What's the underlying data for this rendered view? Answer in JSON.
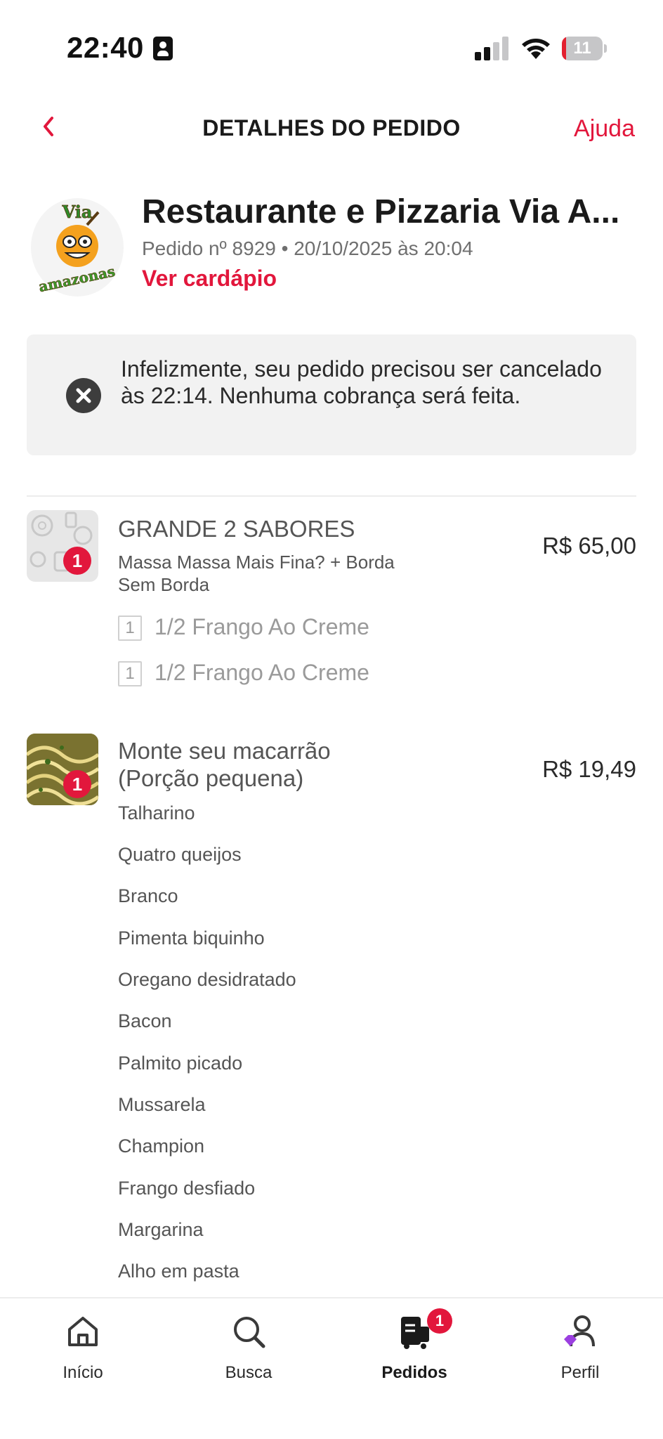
{
  "status_bar": {
    "time": "22:40",
    "battery": "11",
    "battery_level": 0.11
  },
  "header": {
    "title": "DETALHES DO PEDIDO",
    "help_label": "Ajuda"
  },
  "restaurant": {
    "name": "Restaurante e Pizzaria Via A...",
    "order_meta": "Pedido nº 8929 • 20/10/2025 às 20:04",
    "menu_link": "Ver cardápio",
    "logo_text_top": "Via",
    "logo_text_bottom": "amazonas"
  },
  "alert": {
    "icon": "close-circle-icon",
    "message": "Infelizmente, seu pedido precisou ser cancelado às 22:14. Nenhuma cobrança será feita."
  },
  "items": [
    {
      "quantity": "1",
      "name": "GRANDE 2 SABORES",
      "description": "Massa Massa Mais Fina? + Borda Sem Borda",
      "price": "R$ 65,00",
      "subitems": [
        {
          "qty": "1",
          "label": "1/2 Frango Ao Creme"
        },
        {
          "qty": "1",
          "label": "1/2 Frango Ao Creme"
        }
      ]
    },
    {
      "quantity": "1",
      "name_line1": "Monte seu macarrão",
      "name_line2": "(Porção pequena)",
      "price": "R$ 19,49",
      "ingredients": [
        "Talharino",
        "Quatro queijos",
        "Branco",
        "Pimenta biquinho",
        "Oregano desidratado",
        "Bacon",
        "Palmito picado",
        "Mussarela",
        "Champion",
        "Frango desfiado",
        "Margarina",
        "Alho em pasta"
      ]
    }
  ],
  "bottom_nav": {
    "items": [
      {
        "label": "Início",
        "icon": "home-icon"
      },
      {
        "label": "Busca",
        "icon": "search-icon"
      },
      {
        "label": "Pedidos",
        "icon": "orders-icon",
        "badge": "1",
        "active": true
      },
      {
        "label": "Perfil",
        "icon": "profile-icon"
      }
    ]
  },
  "colors": {
    "accent": "#e2173c",
    "text": "#3e3e3e",
    "alert_bg": "#f2f2f2"
  }
}
